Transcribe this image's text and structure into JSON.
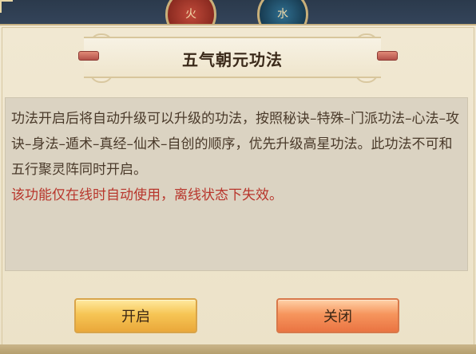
{
  "background": {
    "orb_left_glyph": "火",
    "orb_right_glyph": "水"
  },
  "dialog": {
    "title": "五气朝元功法",
    "description": "功法开启后将自动升级可以升级的功法，按照秘诀–特殊–门派功法–心法–攻诀–身法–遁术–真经–仙术–自创的顺序，优先升级高星功法。此功法不可和五行聚灵阵同时开启。",
    "warning": "该功能仅在线时自动使用，离线状态下失效。",
    "warning_color": "#b8362c"
  },
  "buttons": {
    "open_label": "开启",
    "close_label": "关闭"
  }
}
